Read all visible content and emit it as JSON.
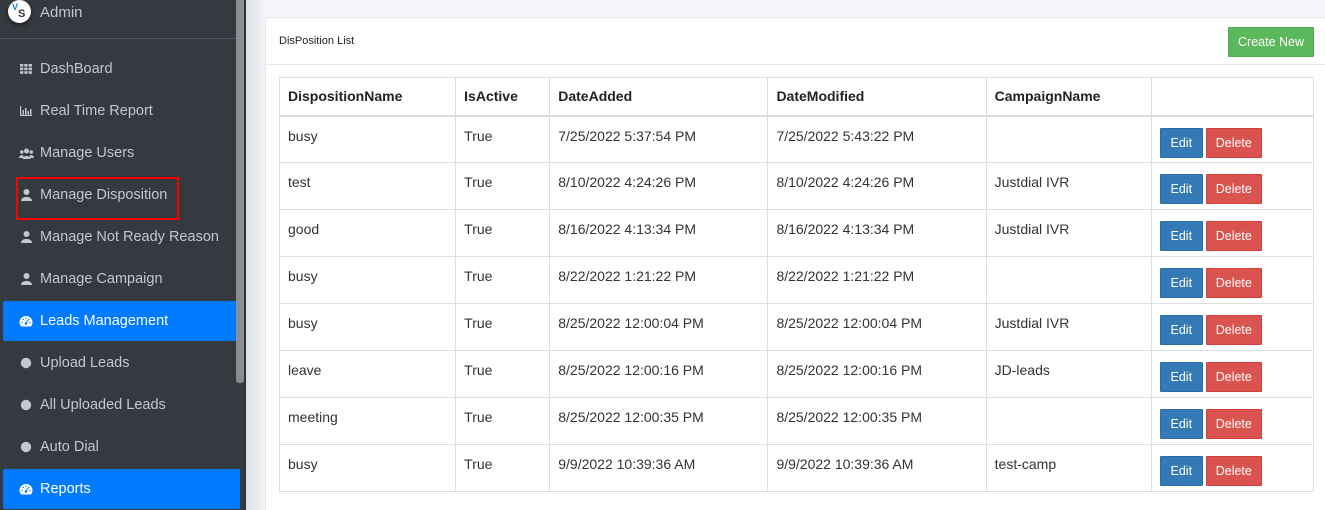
{
  "sidebar": {
    "brand": {
      "logo_text_top": "V",
      "logo_text_bottom": "S",
      "title": "Admin"
    },
    "items": [
      {
        "label": "DashBoard",
        "icon": "grid-icon",
        "active": false
      },
      {
        "label": "Real Time Report",
        "icon": "bar-chart-icon",
        "active": false
      },
      {
        "label": "Manage Users",
        "icon": "users-icon",
        "active": false
      },
      {
        "label": "Manage Disposition",
        "icon": "user-icon",
        "active": false,
        "highlighted": true
      },
      {
        "label": "Manage Not Ready Reason",
        "icon": "user-icon",
        "active": false
      },
      {
        "label": "Manage Campaign",
        "icon": "user-icon",
        "active": false
      },
      {
        "label": "Leads Management",
        "icon": "tachometer-icon",
        "active": true
      },
      {
        "label": "Upload Leads",
        "icon": "circle-icon",
        "active": false
      },
      {
        "label": "All Uploaded Leads",
        "icon": "circle-icon",
        "active": false
      },
      {
        "label": "Auto Dial",
        "icon": "circle-icon",
        "active": false
      },
      {
        "label": "Reports",
        "icon": "tachometer-icon",
        "active": true
      }
    ]
  },
  "card": {
    "title": "DisPosition List",
    "create_button": "Create New"
  },
  "table": {
    "headers": [
      "DispositionName",
      "IsActive",
      "DateAdded",
      "DateModified",
      "CampaignName",
      ""
    ],
    "edit_label": "Edit",
    "delete_label": "Delete",
    "rows": [
      [
        "busy",
        "True",
        "7/25/2022 5:37:54 PM",
        "7/25/2022 5:43:22 PM",
        ""
      ],
      [
        "test",
        "True",
        "8/10/2022 4:24:26 PM",
        "8/10/2022 4:24:26 PM",
        "Justdial IVR"
      ],
      [
        "good",
        "True",
        "8/16/2022 4:13:34 PM",
        "8/16/2022 4:13:34 PM",
        "Justdial IVR"
      ],
      [
        "busy",
        "True",
        "8/22/2022 1:21:22 PM",
        "8/22/2022 1:21:22 PM",
        ""
      ],
      [
        "busy",
        "True",
        "8/25/2022 12:00:04 PM",
        "8/25/2022 12:00:04 PM",
        "Justdial IVR"
      ],
      [
        "leave",
        "True",
        "8/25/2022 12:00:16 PM",
        "8/25/2022 12:00:16 PM",
        "JD-leads"
      ],
      [
        "meeting",
        "True",
        "8/25/2022 12:00:35 PM",
        "8/25/2022 12:00:35 PM",
        ""
      ],
      [
        "busy",
        "True",
        "9/9/2022 10:39:36 AM",
        "9/9/2022 10:39:36 AM",
        "test-camp"
      ]
    ]
  },
  "colors": {
    "sidebar_bg": "#343a40",
    "active_nav": "#007bff",
    "create_button": "#5cb85c",
    "edit_button": "#337ab7",
    "delete_button": "#d9534f",
    "highlight_box": "#ff0000"
  }
}
